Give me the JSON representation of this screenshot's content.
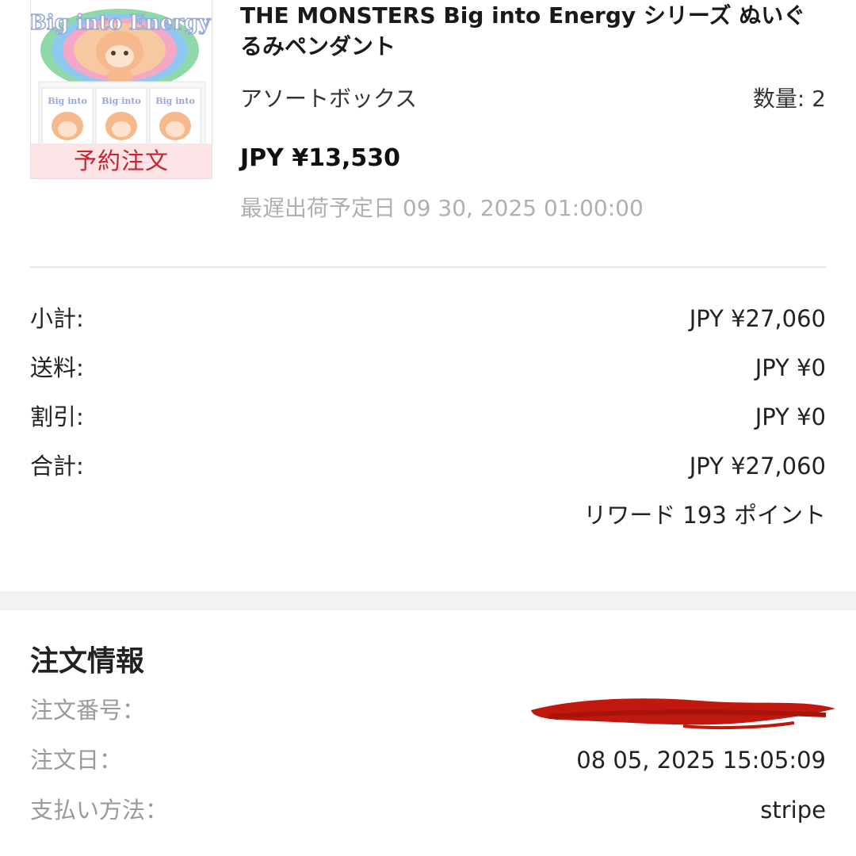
{
  "product": {
    "title": "THE MONSTERS Big into Energy シリーズ ぬいぐるみペンダント",
    "badge": "予約注文",
    "image_text": "Big into Energy",
    "variant": "アソートボックス",
    "quantity": "数量: 2",
    "price": "JPY ¥13,530",
    "ship_date": "最遅出荷予定日 09 30, 2025 01:00:00"
  },
  "totals": {
    "subtotal_label": "小計:",
    "subtotal_value": "JPY ¥27,060",
    "shipping_label": "送料:",
    "shipping_value": "JPY ¥0",
    "discount_label": "割引:",
    "discount_value": "JPY ¥0",
    "total_label": "合計:",
    "total_value": "JPY ¥27,060",
    "reward": "リワード 193 ポイント"
  },
  "order_info": {
    "title": "注文情報",
    "order_number_label": "注文番号：",
    "order_date_label": "注文日：",
    "order_date_value": "08 05, 2025 15:05:09",
    "payment_label": "支払い方法：",
    "payment_value": "stripe"
  },
  "colors": {
    "preorder_text": "#c8232f",
    "preorder_bg": "#fbe3e6",
    "redaction": "#c0180e",
    "muted_text": "#b0b0b0"
  }
}
